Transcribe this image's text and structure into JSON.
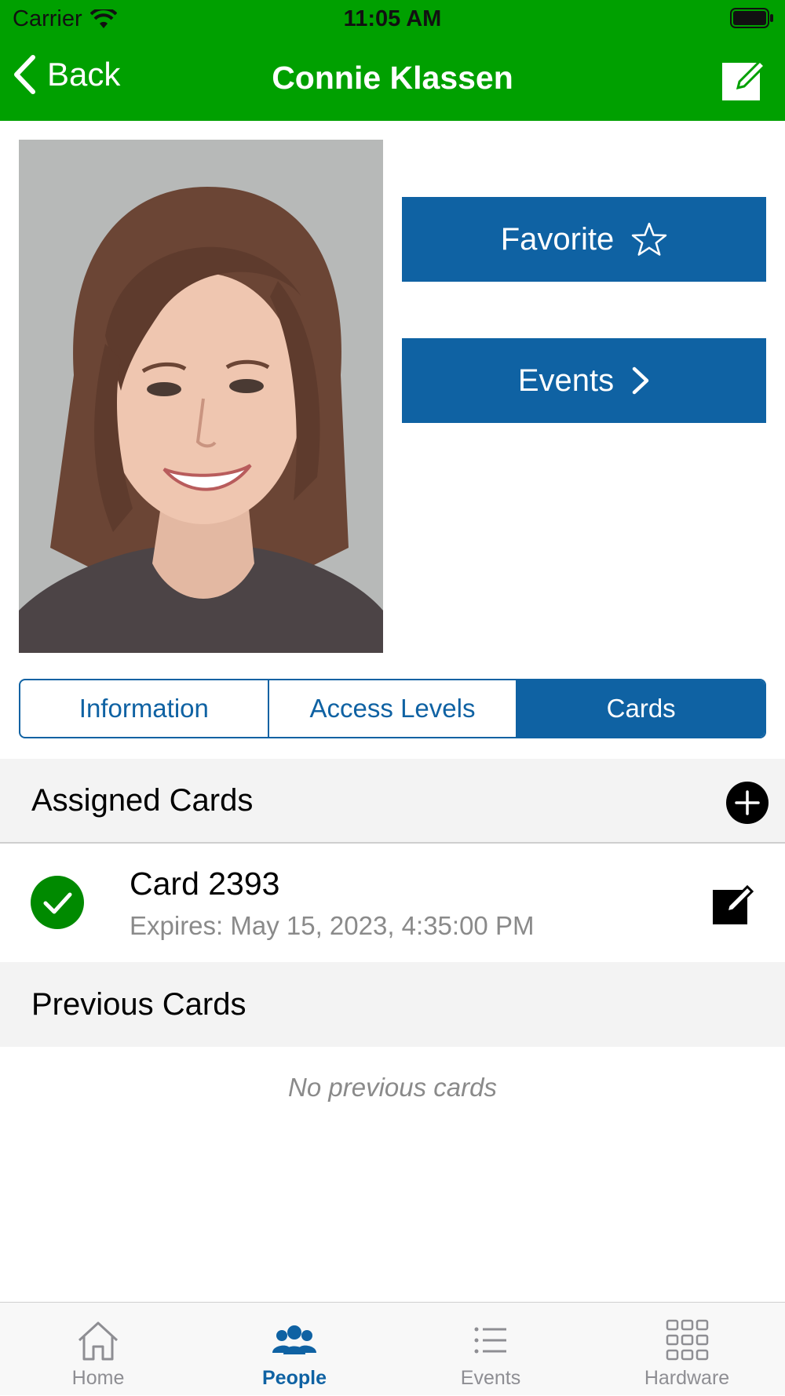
{
  "status_bar": {
    "carrier": "Carrier",
    "time": "11:05 AM"
  },
  "nav": {
    "back_label": "Back",
    "title": "Connie Klassen",
    "edit_icon": "compose-icon"
  },
  "profile": {
    "favorite_label": "Favorite",
    "favorite_icon": "star-outline-icon",
    "events_label": "Events",
    "events_icon": "chevron-right-icon"
  },
  "segments": [
    {
      "label": "Information",
      "active": false
    },
    {
      "label": "Access Levels",
      "active": false
    },
    {
      "label": "Cards",
      "active": true
    }
  ],
  "assigned": {
    "title": "Assigned Cards",
    "add_icon": "plus-circle-icon",
    "cards": [
      {
        "name": "Card 2393",
        "expires": "Expires: May 15, 2023, 4:35:00 PM",
        "status_icon": "check-circle-icon"
      }
    ]
  },
  "previous": {
    "title": "Previous Cards",
    "empty_text": "No previous cards"
  },
  "tabs": [
    {
      "label": "Home",
      "icon": "home-icon",
      "active": false
    },
    {
      "label": "People",
      "icon": "people-icon",
      "active": true
    },
    {
      "label": "Events",
      "icon": "list-icon",
      "active": false
    },
    {
      "label": "Hardware",
      "icon": "grid-icon",
      "active": false
    }
  ],
  "colors": {
    "header_green": "#00a000",
    "accent_blue": "#0f62a3",
    "check_green": "#008a00"
  }
}
